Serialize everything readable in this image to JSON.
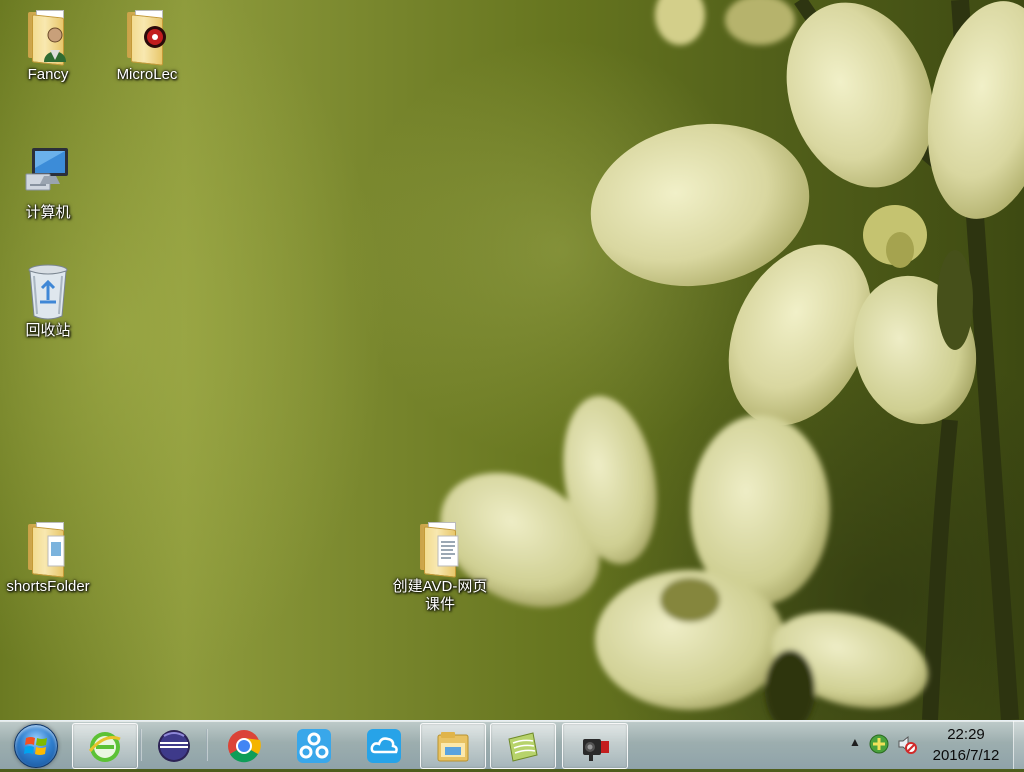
{
  "desktop": {
    "icons": [
      {
        "name": "Fancy",
        "type": "user-folder"
      },
      {
        "name": "MicroLec",
        "type": "media-folder"
      },
      {
        "name": "计算机",
        "type": "computer"
      },
      {
        "name": "回收站",
        "type": "recycle-bin"
      },
      {
        "name": "shortsFolder",
        "type": "folder"
      },
      {
        "name": "创建AVD-网页课件",
        "type": "document-folder"
      }
    ]
  },
  "taskbar": {
    "start": {
      "icon": "windows-start-orb"
    },
    "pinned": [
      {
        "name": "Internet Explorer",
        "icon": "ie-icon",
        "active": true
      },
      {
        "name": "Eclipse",
        "icon": "eclipse-icon",
        "active": false
      },
      {
        "name": "Google Chrome",
        "icon": "chrome-icon",
        "active": false
      },
      {
        "name": "Baidu Netdisk",
        "icon": "baidu-cloud-icon",
        "active": false
      },
      {
        "name": "Cloud Drive",
        "icon": "cloud-icon",
        "active": false
      },
      {
        "name": "Windows Explorer",
        "icon": "explorer-folder-icon",
        "active": true
      },
      {
        "name": "Document App",
        "icon": "document-app-icon",
        "active": true
      },
      {
        "name": "Video Recorder",
        "icon": "video-recorder-icon",
        "active": true
      }
    ],
    "tray": {
      "icons": [
        "show-hidden-icons-chevron",
        "network-plus-icon",
        "volume-muted-icon"
      ],
      "time": "22:29",
      "date": "2016/7/12"
    }
  },
  "colors": {
    "taskbar": "#aebfcc",
    "wallpaper": "#6b7a22",
    "label_text": "#ffffff"
  }
}
